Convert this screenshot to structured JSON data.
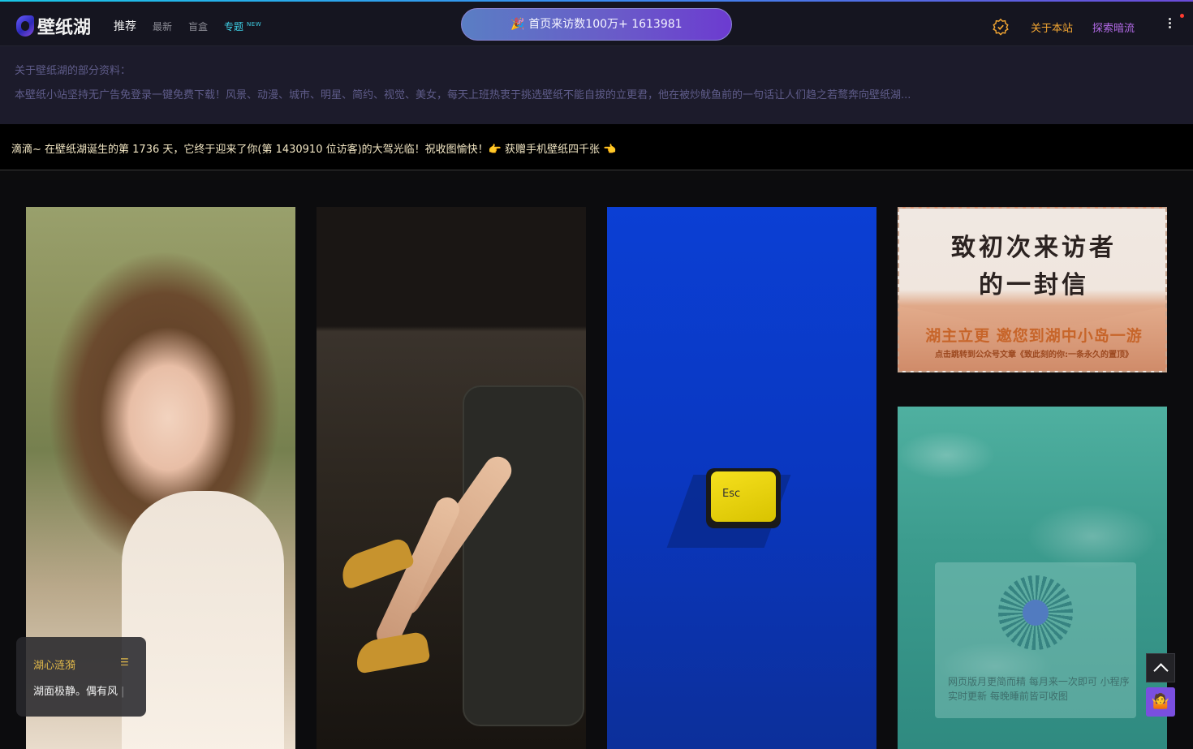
{
  "site": {
    "logo_text": "壁纸湖"
  },
  "nav": {
    "tabs": [
      {
        "label": "推荐"
      },
      {
        "label": "最新"
      },
      {
        "label": "盲盒"
      },
      {
        "label": "专题",
        "badge": "NEW"
      }
    ],
    "visit_banner": "🎉 首页来访数100万+ 1613981",
    "about_label": "关于本站",
    "explore_label": "探索暗流",
    "accent_colors": {
      "about": "#f3a632",
      "explore": "#b26ae6",
      "special": "#3fd2e8"
    }
  },
  "info": {
    "title": "关于壁纸湖的部分资料：",
    "text": "本壁纸小站坚持无广告免登录一键免费下载！风景、动漫、城市、明星、简约、视觉、美女，每天上班热衷于挑选壁纸不能自拔的立更君，他在被炒鱿鱼前的一句话让人们趋之若鹜奔向壁纸湖..."
  },
  "welcome": {
    "text": "滴滴~ 在壁纸湖诞生的第 1736 天，它终于迎来了你(第 1430910 位访客)的大驾光临！祝收图愉快！👉 获赠手机壁纸四千张 👈"
  },
  "cards": {
    "letter": {
      "title_line1": "致初次来访者",
      "title_line2": "的一封信",
      "subtitle": "湖主立更 邀您到湖中小岛一游",
      "note": "点击跳转到公众号文章《致此刻的你:一条永久的置顶》"
    },
    "esc_key_label": "Esc",
    "qr": {
      "text": "网页版月更简而精 每月来一次即可 小程序实时更新 每晚睡前皆可收图"
    }
  },
  "poem": {
    "title": "湖心涟漪",
    "menu_icon": "☰",
    "line": "湖面极静。偶有风"
  },
  "floating": {
    "avatar_icon": "🤷"
  }
}
